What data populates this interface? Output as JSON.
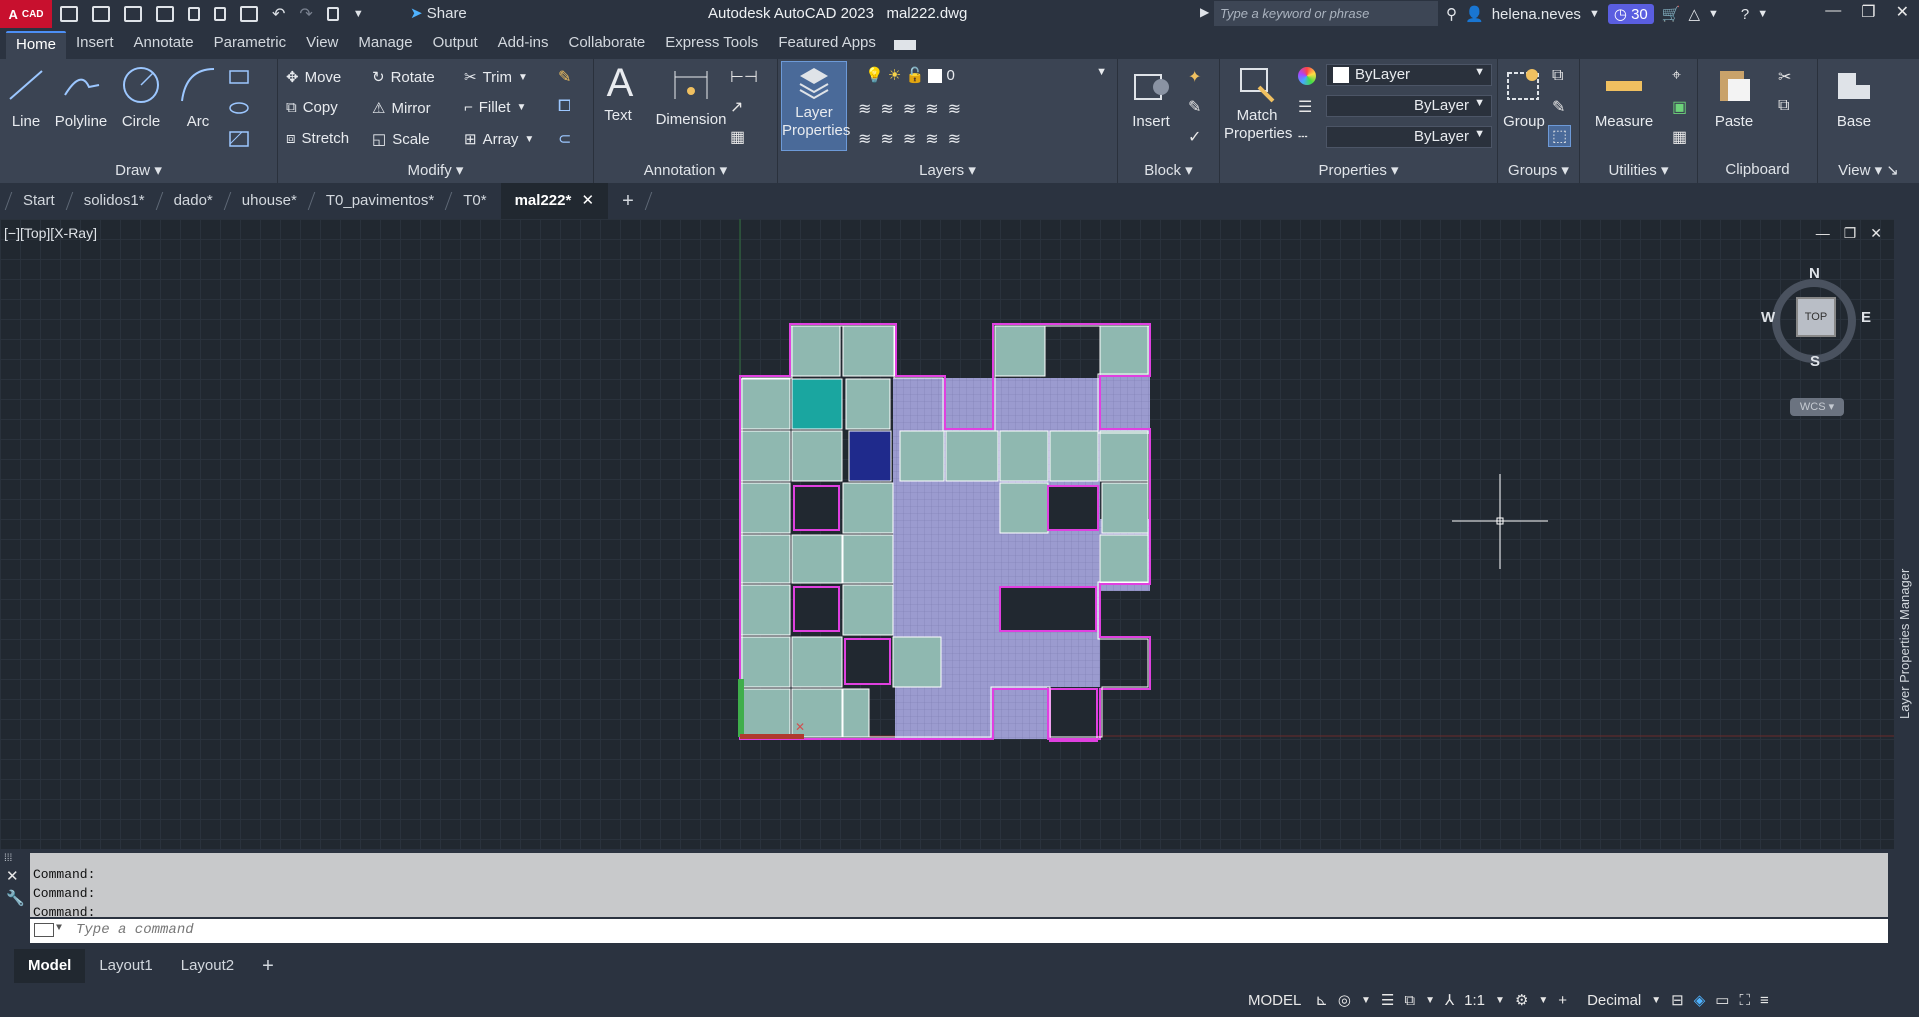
{
  "app": {
    "logo_letter": "A",
    "logo_text": "CAD",
    "title": "Autodesk AutoCAD 2023",
    "filename": "mal222.dwg"
  },
  "titlebar": {
    "share_label": "Share",
    "search_placeholder": "Type a keyword or phrase",
    "user": "helena.neves",
    "timer": "30"
  },
  "ribbon_tabs": [
    "Home",
    "Insert",
    "Annotate",
    "Parametric",
    "View",
    "Manage",
    "Output",
    "Add-ins",
    "Collaborate",
    "Express Tools",
    "Featured Apps"
  ],
  "ribbon": {
    "draw": {
      "label": "Draw",
      "line": "Line",
      "polyline": "Polyline",
      "circle": "Circle",
      "arc": "Arc"
    },
    "modify": {
      "label": "Modify",
      "move": "Move",
      "rotate": "Rotate",
      "trim": "Trim",
      "copy": "Copy",
      "mirror": "Mirror",
      "fillet": "Fillet",
      "stretch": "Stretch",
      "scale": "Scale",
      "array": "Array"
    },
    "annotation": {
      "label": "Annotation",
      "text": "Text",
      "dimension": "Dimension"
    },
    "layers": {
      "label": "Layers",
      "layer_properties_1": "Layer",
      "layer_properties_2": "Properties",
      "current_layer": "0"
    },
    "block": {
      "label": "Block",
      "insert": "Insert"
    },
    "properties": {
      "label": "Properties",
      "match_1": "Match",
      "match_2": "Properties",
      "color": "ByLayer",
      "linetype": "ByLayer",
      "lineweight": "ByLayer"
    },
    "groups": {
      "label": "Groups",
      "group": "Group"
    },
    "utilities": {
      "label": "Utilities",
      "measure": "Measure"
    },
    "clipboard": {
      "label": "Clipboard",
      "paste": "Paste"
    },
    "view": {
      "label": "View",
      "base": "Base"
    }
  },
  "doc_tabs": [
    "Start",
    "solidos1*",
    "dado*",
    "uhouse*",
    "T0_pavimentos*",
    "T0*",
    "mal222*"
  ],
  "viewport": {
    "label": "[−][Top][X-Ray]",
    "compass": {
      "n": "N",
      "s": "S",
      "e": "E",
      "w": "W",
      "top": "TOP",
      "wcs": "WCS"
    }
  },
  "side_panel": {
    "label": "Layer Properties Manager"
  },
  "command": {
    "history": [
      "Command:",
      "Command:",
      "Command:"
    ],
    "placeholder": "Type a command"
  },
  "layout_tabs": [
    "Model",
    "Layout1",
    "Layout2"
  ],
  "status": {
    "model": "MODEL",
    "scale": "1:1",
    "units": "Decimal"
  },
  "colors": {
    "accent": "#4c8ff5",
    "brand": "#c8102e",
    "magenta": "#e040e0",
    "teal_fill": "#8fb8b0",
    "lavender_fill": "#9b9bcf",
    "navy_fill": "#1f2a8c",
    "cyan_fill": "#1aa6a0"
  }
}
